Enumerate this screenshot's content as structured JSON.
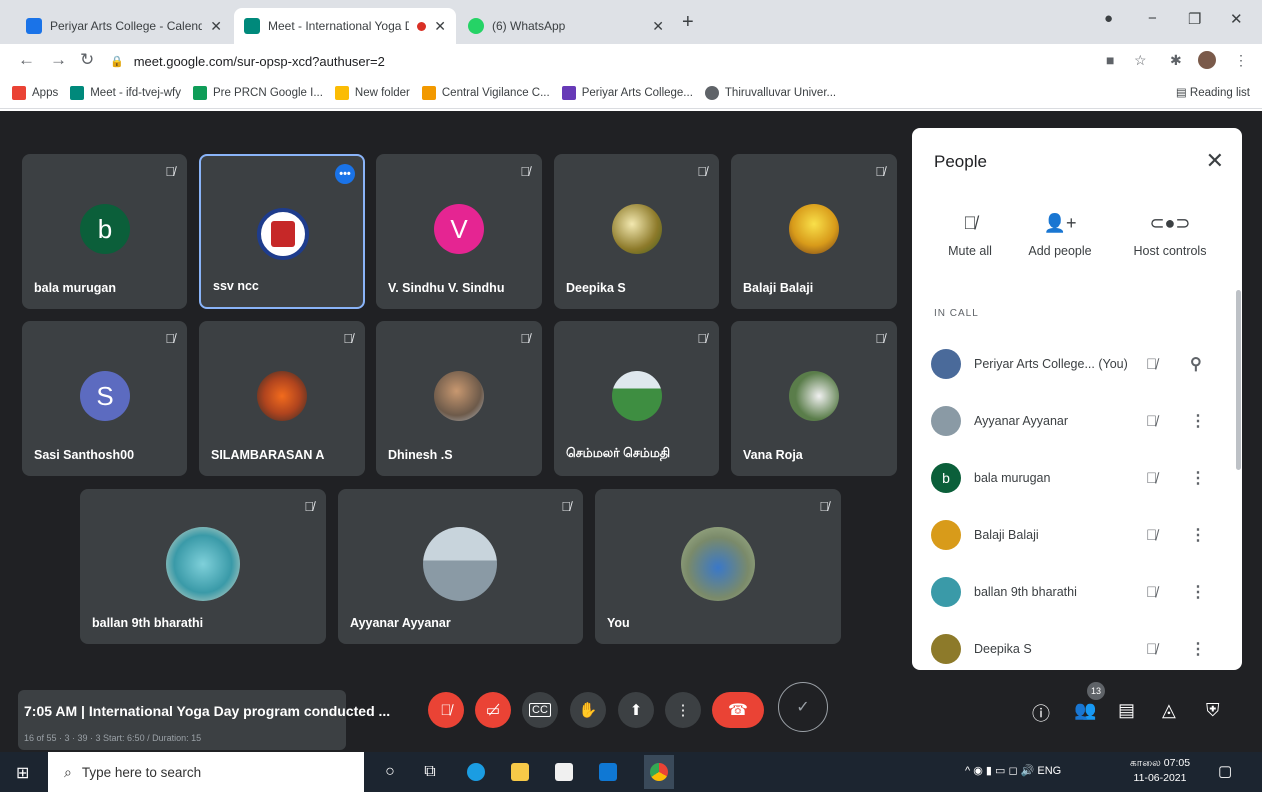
{
  "tabs": [
    {
      "title": "Periyar Arts College - Calendar -",
      "color": "#1a73e8"
    },
    {
      "title": "Meet - International Yoga Da",
      "color": "#00897b"
    },
    {
      "title": "(6) WhatsApp",
      "color": "#25d366"
    }
  ],
  "url": "meet.google.com/sur-opsp-xcd?authuser=2",
  "bookmarks": [
    {
      "label": "Apps",
      "color": "#ea4335"
    },
    {
      "label": "Meet - ifd-tvej-wfy",
      "color": "#00897b"
    },
    {
      "label": "Pre PRCN Google I...",
      "color": "#0f9d58"
    },
    {
      "label": "New folder",
      "color": "#fbbc04"
    },
    {
      "label": "Central Vigilance C...",
      "color": "#f29900"
    },
    {
      "label": "Periyar Arts College...",
      "color": "#673ab7"
    },
    {
      "label": "Thiruvalluvar Univer...",
      "color": "#5f6368"
    }
  ],
  "reading_list": "Reading list",
  "tiles": [
    {
      "name": "bala murugan",
      "initial": "b",
      "color": "#0b5f3a"
    },
    {
      "name": "ssv ncc",
      "initial": "",
      "color": "#1e3c8c"
    },
    {
      "name": "V. Sindhu V. Sindhu",
      "initial": "V",
      "color": "#e52592"
    },
    {
      "name": "Deepika S",
      "initial": "",
      "color": "#8d7a2a"
    },
    {
      "name": "Balaji Balaji",
      "initial": "",
      "color": "#d89b1a"
    },
    {
      "name": "Sasi Santhosh00",
      "initial": "S",
      "color": "#5c6bc0"
    },
    {
      "name": "SILAMBARASAN A",
      "initial": "",
      "color": "#b0441e"
    },
    {
      "name": "Dhinesh .S",
      "initial": "",
      "color": "#6d5a4a"
    },
    {
      "name": "செம்மலர் செம்மதி",
      "initial": "",
      "color": "#3e8e41"
    },
    {
      "name": "Vana Roja",
      "initial": "",
      "color": "#5a7d4a"
    },
    {
      "name": "ballan 9th bharathi",
      "initial": "",
      "color": "#3a9aa8"
    },
    {
      "name": "Ayyanar Ayyanar",
      "initial": "",
      "color": "#8a9aa5"
    },
    {
      "name": "You",
      "initial": "",
      "color": "#7a8a6a"
    }
  ],
  "panel": {
    "title": "People",
    "actions": [
      "Mute all",
      "Add people",
      "Host controls"
    ],
    "section": "IN CALL",
    "people": [
      {
        "name": "Periyar Arts College... (You)",
        "initial": "",
        "color": "#4a6a9a"
      },
      {
        "name": "Ayyanar Ayyanar",
        "initial": "",
        "color": "#8a9aa5"
      },
      {
        "name": "bala murugan",
        "initial": "b",
        "color": "#0b5f3a"
      },
      {
        "name": "Balaji Balaji",
        "initial": "",
        "color": "#d89b1a"
      },
      {
        "name": "ballan 9th bharathi",
        "initial": "",
        "color": "#3a9aa8"
      },
      {
        "name": "Deepika S",
        "initial": "",
        "color": "#8d7a2a"
      }
    ]
  },
  "meeting": {
    "time": "7:05 AM",
    "title": "International Yoga Day program conducted ...",
    "subtext": "16 of 55 · 3 · 39 · 3 Start: 6:50 / Duration: 15"
  },
  "participant_count": "13",
  "taskbar": {
    "search_placeholder": "Type here to search",
    "lang": "ENG",
    "time": "காலை 07:05",
    "date": "11-06-2021"
  }
}
